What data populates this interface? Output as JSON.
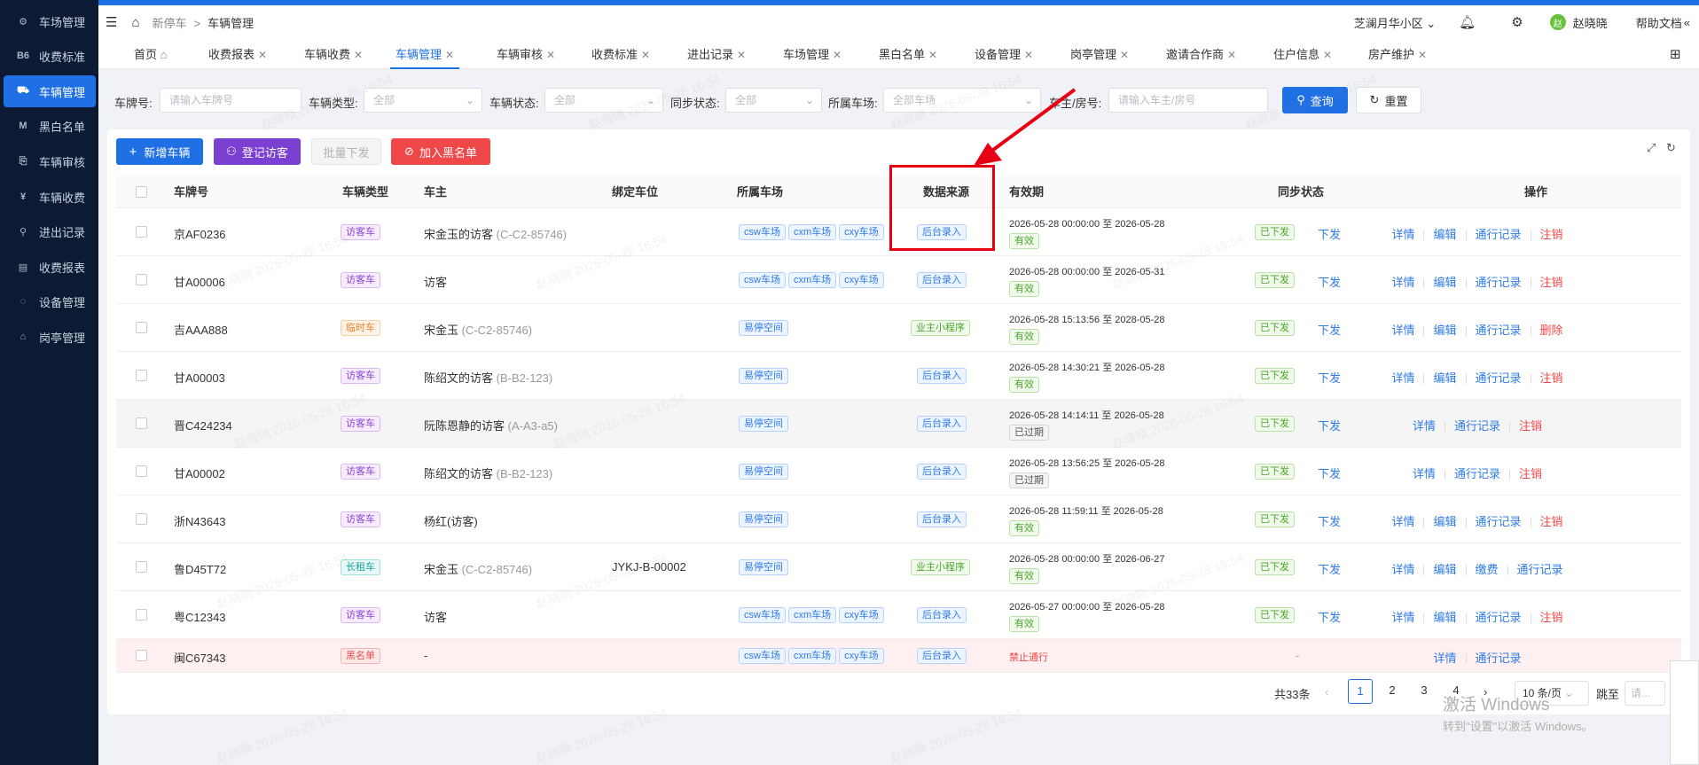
{
  "sidebar": {
    "items": [
      {
        "icon": "gear-icon",
        "glyph": "⚙",
        "label": "车场管理"
      },
      {
        "icon": "bs-icon",
        "glyph": "B6",
        "label": "收费标准"
      },
      {
        "icon": "car-icon",
        "glyph": "🚘",
        "label": "车辆管理"
      },
      {
        "icon": "m-icon",
        "glyph": "M",
        "label": "黑白名单"
      },
      {
        "icon": "audit-icon",
        "glyph": "⎘",
        "label": "车辆审核"
      },
      {
        "icon": "money-icon",
        "glyph": "¥",
        "label": "车辆收费"
      },
      {
        "icon": "record-icon",
        "glyph": "⚲",
        "label": "进出记录"
      },
      {
        "icon": "report-icon",
        "glyph": "▤",
        "label": "收费报表"
      },
      {
        "icon": "device-icon",
        "glyph": "◌",
        "label": "设备管理"
      },
      {
        "icon": "booth-icon",
        "glyph": "⌂",
        "label": "岗亭管理"
      }
    ]
  },
  "header": {
    "breadcrumb_parent": "新停车",
    "breadcrumb_sep": ">",
    "breadcrumb_current": "车辆管理",
    "community": "芝澜月华小区",
    "user_initial": "赵",
    "user_name": "赵晓晓",
    "help": "帮助文档"
  },
  "tabs": [
    {
      "label": "首页"
    },
    {
      "label": "收费报表"
    },
    {
      "label": "车辆收费"
    },
    {
      "label": "车辆管理"
    },
    {
      "label": "车辆审核"
    },
    {
      "label": "收费标准"
    },
    {
      "label": "进出记录"
    },
    {
      "label": "车场管理"
    },
    {
      "label": "黑白名单"
    },
    {
      "label": "设备管理"
    },
    {
      "label": "岗亭管理"
    },
    {
      "label": "邀请合作商"
    },
    {
      "label": "住户信息"
    },
    {
      "label": "房产维护"
    }
  ],
  "filters": {
    "plate_label": "车牌号:",
    "plate_placeholder": "请输入车牌号",
    "type_label": "车辆类型:",
    "type_value": "全部",
    "status_label": "车辆状态:",
    "status_value": "全部",
    "sync_label": "同步状态:",
    "sync_value": "全部",
    "lot_label": "所属车场:",
    "lot_value": "全部车场",
    "owner_label": "车主/房号:",
    "owner_placeholder": "请输入车主/房号",
    "query": "查询",
    "reset": "重置"
  },
  "actions": {
    "add": "新增车辆",
    "visitor": "登记访客",
    "batch": "批量下发",
    "blacklist": "加入黑名单"
  },
  "table": {
    "columns": [
      "车牌号",
      "车辆类型",
      "车主",
      "绑定车位",
      "所属车场",
      "数据来源",
      "有效期",
      "同步状态",
      "操作"
    ],
    "rows": [
      {
        "plate": "京AF0236",
        "type": "访客车",
        "owner": "宋金玉的访客",
        "owner_sub": "(C-C2-85746)",
        "slot": "",
        "lots": [
          "csw车场",
          "cxm车场",
          "cxy车场"
        ],
        "source": "后台录入",
        "validity": "2026-05-28 00:00:00 至 2026-05-28",
        "vstatus": "有效",
        "sync": "已下发",
        "sync_action": "下发",
        "ops": [
          "详情",
          "编辑",
          "通行记录",
          "注销"
        ]
      },
      {
        "plate": "甘A00006",
        "type": "访客车",
        "owner": "访客",
        "owner_sub": "",
        "slot": "",
        "lots": [
          "csw车场",
          "cxm车场",
          "cxy车场"
        ],
        "source": "后台录入",
        "validity": "2026-05-28 00:00:00 至 2026-05-31",
        "vstatus": "有效",
        "sync": "已下发",
        "sync_action": "下发",
        "ops": [
          "详情",
          "编辑",
          "通行记录",
          "注销"
        ]
      },
      {
        "plate": "吉AAA888",
        "type": "临时车",
        "owner": "宋金玉",
        "owner_sub": "(C-C2-85746)",
        "slot": "",
        "lots": [
          "易停空间"
        ],
        "source": "业主小程序",
        "validity": "2026-05-28 15:13:56 至 2028-05-28",
        "vstatus": "有效",
        "sync": "已下发",
        "sync_action": "下发",
        "ops": [
          "详情",
          "编辑",
          "通行记录",
          "删除"
        ]
      },
      {
        "plate": "甘A00003",
        "type": "访客车",
        "owner": "陈绍文的访客",
        "owner_sub": "(B-B2-123)",
        "slot": "",
        "lots": [
          "易停空间"
        ],
        "source": "后台录入",
        "validity": "2026-05-28 14:30:21 至 2026-05-28",
        "vstatus": "有效",
        "sync": "已下发",
        "sync_action": "下发",
        "ops": [
          "详情",
          "编辑",
          "通行记录",
          "注销"
        ]
      },
      {
        "plate": "晋C424234",
        "type": "访客车",
        "owner": "阮陈恩静的访客",
        "owner_sub": "(A-A3-a5)",
        "slot": "",
        "lots": [
          "易停空间"
        ],
        "source": "后台录入",
        "validity": "2026-05-28 14:14:11 至 2026-05-28",
        "vstatus": "已过期",
        "sync": "已下发",
        "sync_action": "下发",
        "ops": [
          "详情",
          "通行记录",
          "注销"
        ]
      },
      {
        "plate": "甘A00002",
        "type": "访客车",
        "owner": "陈绍文的访客",
        "owner_sub": "(B-B2-123)",
        "slot": "",
        "lots": [
          "易停空间"
        ],
        "source": "后台录入",
        "validity": "2026-05-28 13:56:25 至 2026-05-28",
        "vstatus": "已过期",
        "sync": "已下发",
        "sync_action": "下发",
        "ops": [
          "详情",
          "通行记录",
          "注销"
        ]
      },
      {
        "plate": "浙N43643",
        "type": "访客车",
        "owner": "杨红(访客)",
        "owner_sub": "",
        "slot": "",
        "lots": [
          "易停空间"
        ],
        "source": "后台录入",
        "validity": "2026-05-28 11:59:11 至 2026-05-28",
        "vstatus": "有效",
        "sync": "已下发",
        "sync_action": "下发",
        "ops": [
          "详情",
          "编辑",
          "通行记录",
          "注销"
        ]
      },
      {
        "plate": "鲁D45T72",
        "type": "长租车",
        "owner": "宋金玉",
        "owner_sub": "(C-C2-85746)",
        "slot": "JYKJ-B-00002",
        "lots": [
          "易停空间"
        ],
        "source": "业主小程序",
        "validity": "2026-05-28 00:00:00 至 2026-06-27",
        "vstatus": "有效",
        "sync": "已下发",
        "sync_action": "下发",
        "ops": [
          "详情",
          "编辑",
          "缴费",
          "通行记录"
        ]
      },
      {
        "plate": "粤C12343",
        "type": "访客车",
        "owner": "访客",
        "owner_sub": "",
        "slot": "",
        "lots": [
          "csw车场",
          "cxm车场",
          "cxy车场"
        ],
        "source": "后台录入",
        "validity": "2026-05-27 00:00:00 至 2026-05-28",
        "vstatus": "有效",
        "sync": "已下发",
        "sync_action": "下发",
        "ops": [
          "详情",
          "编辑",
          "通行记录",
          "注销"
        ]
      },
      {
        "plate": "闽C67343",
        "type": "黑名单",
        "owner": "-",
        "owner_sub": "",
        "slot": "",
        "lots": [
          "csw车场",
          "cxm车场",
          "cxy车场"
        ],
        "source": "后台录入",
        "validity": "禁止通行",
        "vstatus": "",
        "sync": "-",
        "sync_action": "",
        "ops": [
          "详情",
          "通行记录"
        ]
      }
    ]
  },
  "pagination": {
    "total": "共33条",
    "pages": [
      "1",
      "2",
      "3",
      "4"
    ],
    "page_size": "10 条/页",
    "jump_label": "跳至",
    "jump_placeholder": "请..."
  },
  "watermark": "赵晓晓 2026-05-28 16:54",
  "windows_activation": {
    "line1": "激活 Windows",
    "line2": "转到\"设置\"以激活 Windows。"
  },
  "colors": {
    "sidebar_bg": "#0c1a33",
    "accent": "#1f6fe5",
    "visitor_btn": "#7b3fd1",
    "danger": "#f04848",
    "annotation": "#e60012"
  }
}
